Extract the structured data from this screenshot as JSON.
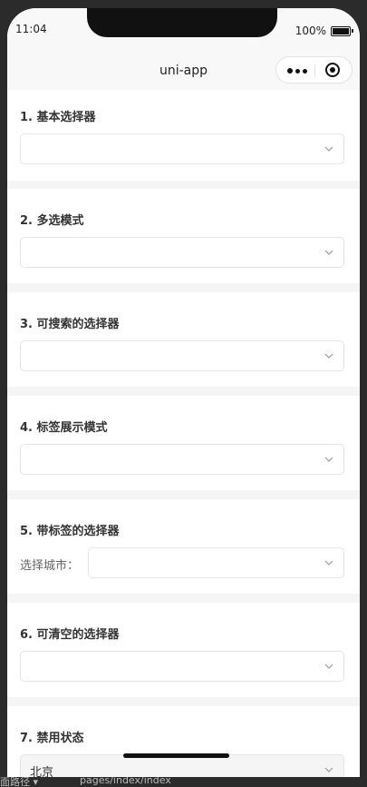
{
  "status_bar": {
    "time": "11:04",
    "battery": "100%"
  },
  "navbar": {
    "title": "uni-app"
  },
  "sections": [
    {
      "title": "1. 基本选择器",
      "value": ""
    },
    {
      "title": "2. 多选模式",
      "value": ""
    },
    {
      "title": "3. 可搜索的选择器",
      "value": ""
    },
    {
      "title": "4. 标签展示模式",
      "value": ""
    },
    {
      "title": "5. 带标签的选择器",
      "label": "选择城市：",
      "value": ""
    },
    {
      "title": "6. 可清空的选择器",
      "value": ""
    },
    {
      "title": "7. 禁用状态",
      "value": "北京"
    }
  ],
  "footer": {
    "path_prefix": "面路径 ▾",
    "path": "pages/index/index"
  }
}
